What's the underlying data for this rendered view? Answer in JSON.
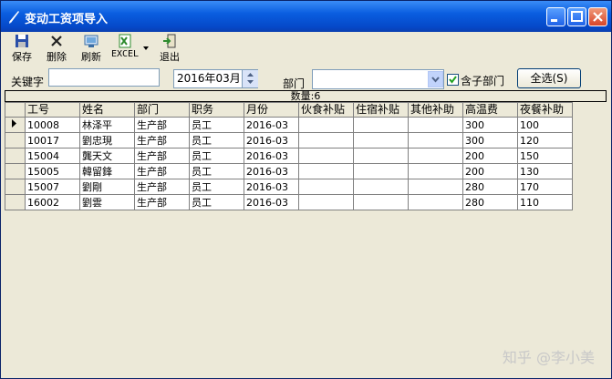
{
  "window": {
    "title": "变动工资项导入"
  },
  "toolbar": {
    "items": [
      {
        "label": "保存",
        "icon": "save-icon"
      },
      {
        "label": "删除",
        "icon": "delete-icon"
      },
      {
        "label": "刷新",
        "icon": "refresh-icon"
      },
      {
        "label": "EXCEL",
        "icon": "excel-icon"
      },
      {
        "label": "退出",
        "icon": "exit-icon"
      }
    ]
  },
  "filter": {
    "keyword_label": "关键字",
    "keyword_value": "",
    "month_value": "2016年03月",
    "dept_label": "部门",
    "dept_value": "",
    "include_sub_label": "含子部门",
    "include_sub_checked": true,
    "select_all_label": "全选(S)"
  },
  "grid": {
    "count_text": "数量:6",
    "columns": [
      "工号",
      "姓名",
      "部门",
      "职务",
      "月份",
      "伙食补贴",
      "住宿补贴",
      "其他补助",
      "高温费",
      "夜餐补助"
    ],
    "rows": [
      [
        "10008",
        "林泽平",
        "生产部",
        "员工",
        "2016-03",
        "",
        "",
        "",
        "300",
        "100"
      ],
      [
        "10017",
        "劉忠現",
        "生产部",
        "员工",
        "2016-03",
        "",
        "",
        "",
        "300",
        "120"
      ],
      [
        "15004",
        "龔天文",
        "生产部",
        "员工",
        "2016-03",
        "",
        "",
        "",
        "200",
        "150"
      ],
      [
        "15005",
        "韓留鋒",
        "生产部",
        "员工",
        "2016-03",
        "",
        "",
        "",
        "200",
        "130"
      ],
      [
        "15007",
        "劉剛",
        "生产部",
        "员工",
        "2016-03",
        "",
        "",
        "",
        "280",
        "170"
      ],
      [
        "16002",
        "劉雲",
        "生产部",
        "员工",
        "2016-03",
        "",
        "",
        "",
        "280",
        "110"
      ]
    ]
  },
  "watermark": "知乎 @李小美",
  "colors": {
    "title_bar": "#0a5ee0",
    "excel_green": "#2e8b2e"
  }
}
